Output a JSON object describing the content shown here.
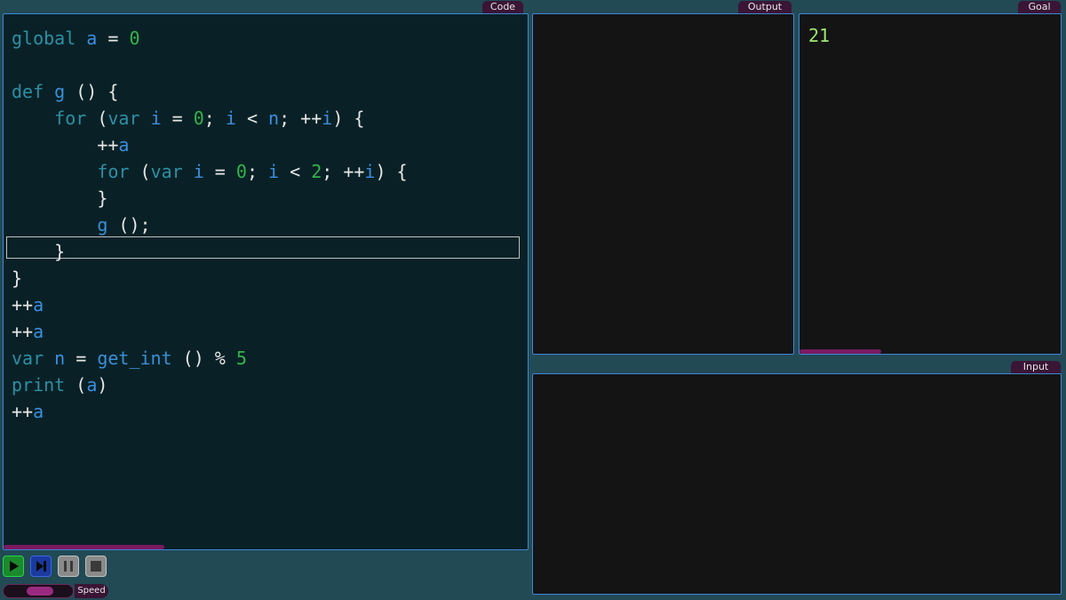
{
  "panels": {
    "code": "Code",
    "output": "Output",
    "goal": "Goal",
    "input": "Input"
  },
  "code_lines": [
    [
      {
        "t": "global",
        "c": "kw"
      },
      {
        "t": " ",
        "c": "op"
      },
      {
        "t": "a",
        "c": "id"
      },
      {
        "t": " = ",
        "c": "op"
      },
      {
        "t": "0",
        "c": "num"
      }
    ],
    [],
    [
      {
        "t": "def",
        "c": "kw"
      },
      {
        "t": " ",
        "c": "op"
      },
      {
        "t": "g",
        "c": "fn"
      },
      {
        "t": " () {",
        "c": "op"
      }
    ],
    [
      {
        "t": "    ",
        "c": "op"
      },
      {
        "t": "for",
        "c": "kw"
      },
      {
        "t": " (",
        "c": "op"
      },
      {
        "t": "var",
        "c": "kw"
      },
      {
        "t": " ",
        "c": "op"
      },
      {
        "t": "i",
        "c": "id"
      },
      {
        "t": " = ",
        "c": "op"
      },
      {
        "t": "0",
        "c": "num"
      },
      {
        "t": "; ",
        "c": "op"
      },
      {
        "t": "i",
        "c": "id"
      },
      {
        "t": " < ",
        "c": "op"
      },
      {
        "t": "n",
        "c": "id"
      },
      {
        "t": "; ++",
        "c": "op"
      },
      {
        "t": "i",
        "c": "id"
      },
      {
        "t": ") {",
        "c": "op"
      }
    ],
    [
      {
        "t": "        ++",
        "c": "op"
      },
      {
        "t": "a",
        "c": "id"
      }
    ],
    [
      {
        "t": "        ",
        "c": "op"
      },
      {
        "t": "for",
        "c": "kw"
      },
      {
        "t": " (",
        "c": "op"
      },
      {
        "t": "var",
        "c": "kw"
      },
      {
        "t": " ",
        "c": "op"
      },
      {
        "t": "i",
        "c": "id"
      },
      {
        "t": " = ",
        "c": "op"
      },
      {
        "t": "0",
        "c": "num"
      },
      {
        "t": "; ",
        "c": "op"
      },
      {
        "t": "i",
        "c": "id"
      },
      {
        "t": " < ",
        "c": "op"
      },
      {
        "t": "2",
        "c": "num"
      },
      {
        "t": "; ++",
        "c": "op"
      },
      {
        "t": "i",
        "c": "id"
      },
      {
        "t": ") {",
        "c": "op"
      }
    ],
    [
      {
        "t": "        }",
        "c": "op"
      }
    ],
    [
      {
        "t": "        ",
        "c": "op"
      },
      {
        "t": "g",
        "c": "fn"
      },
      {
        "t": " ();",
        "c": "op"
      }
    ],
    [
      {
        "t": "    }",
        "c": "op"
      }
    ],
    [
      {
        "t": "}",
        "c": "op"
      }
    ],
    [
      {
        "t": "++",
        "c": "op"
      },
      {
        "t": "a",
        "c": "id"
      }
    ],
    [
      {
        "t": "++",
        "c": "op"
      },
      {
        "t": "a",
        "c": "id"
      }
    ],
    [
      {
        "t": "var",
        "c": "kw"
      },
      {
        "t": " ",
        "c": "op"
      },
      {
        "t": "n",
        "c": "id"
      },
      {
        "t": " = ",
        "c": "op"
      },
      {
        "t": "get_int",
        "c": "fn"
      },
      {
        "t": " () % ",
        "c": "op"
      },
      {
        "t": "5",
        "c": "num"
      }
    ],
    [
      {
        "t": "print",
        "c": "kw"
      },
      {
        "t": " (",
        "c": "op"
      },
      {
        "t": "a",
        "c": "id"
      },
      {
        "t": ")",
        "c": "op"
      }
    ],
    [
      {
        "t": "++",
        "c": "op"
      },
      {
        "t": "a",
        "c": "id"
      }
    ]
  ],
  "highlighted_line": 8,
  "output_text": "",
  "goal_text": "21",
  "input_text": "",
  "controls": {
    "speed_label": "Speed",
    "speed_value": 0.55
  },
  "icons": {
    "play": "play-icon",
    "step": "step-icon",
    "pause": "pause-icon",
    "stop": "stop-icon"
  },
  "colors": {
    "background": "#214a55",
    "code_bg": "#092126",
    "panel_bg": "#141414",
    "panel_border": "#3f86d8",
    "keyword": "#2d8fa6",
    "identifier": "#3b8ee0",
    "number": "#34b34a",
    "goal_text": "#9fe870",
    "tab_bg": "#3a1535"
  }
}
